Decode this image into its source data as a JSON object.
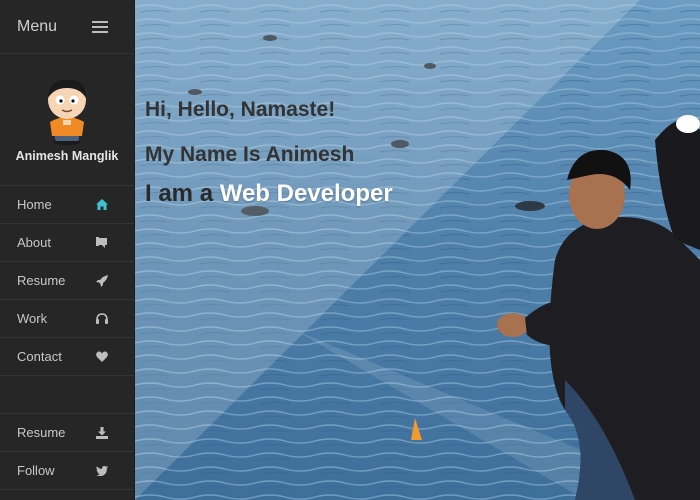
{
  "sidebar": {
    "menu_label": "Menu",
    "menu_icon": "hamburger-icon",
    "profile_name": "Animesh Manglik",
    "items": [
      {
        "label": "Home",
        "icon": "home-icon",
        "active": true
      },
      {
        "label": "About",
        "icon": "book-icon"
      },
      {
        "label": "Resume",
        "icon": "rocket-icon"
      },
      {
        "label": "Work",
        "icon": "headphones-icon"
      },
      {
        "label": "Contact",
        "icon": "heart-icon"
      }
    ],
    "bottom_items": [
      {
        "label": "Resume",
        "icon": "download-icon"
      },
      {
        "label": "Follow",
        "icon": "twitter-icon"
      }
    ]
  },
  "hero": {
    "line1": "Hi, Hello, Namaste!",
    "line2": "My Name Is Animesh",
    "line3_prefix": "I am a ",
    "line3_role": "Web Developer"
  },
  "colors": {
    "accent": "#3ec1d3",
    "sidebar_bg": "#262626",
    "water": "#4b7ca6"
  }
}
